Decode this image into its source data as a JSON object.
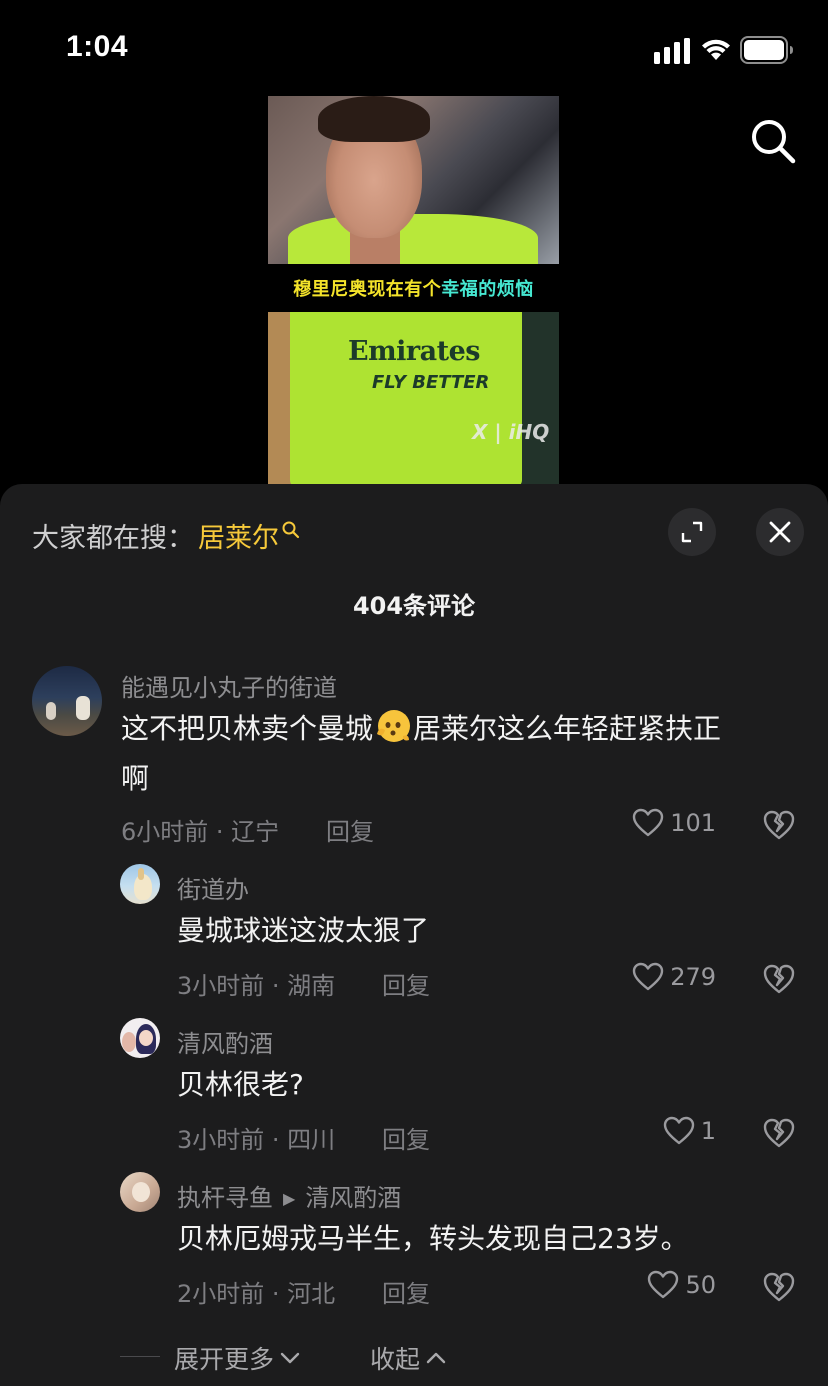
{
  "status_bar": {
    "time": "1:04"
  },
  "video": {
    "caption_a": "穆里尼奥现在有个",
    "caption_b": "幸福的烦恼",
    "sponsor_line1": "Emirates",
    "sponsor_line2": "FLY BETTER",
    "watermark": "X | iHQ"
  },
  "sheet": {
    "trending_prefix": "大家都在搜：",
    "trending_keyword": "居莱尔",
    "comment_count": "404条评论",
    "expand_more": "展开更多",
    "collapse": "收起"
  },
  "comments": [
    {
      "user": "能遇见小丸子的街道",
      "text": "这不把贝林卖个曼城🫣居莱尔这么年轻赶紧扶正啊",
      "text_part1": "这不把贝林卖个曼城",
      "text_part2": "居莱尔这么年轻赶紧扶正",
      "text_part3": "啊",
      "meta": "6小时前 · 辽宁",
      "reply": "回复",
      "likes": "101"
    },
    {
      "user": "街道办",
      "text": "曼城球迷这波太狠了",
      "meta": "3小时前 · 湖南",
      "reply": "回复",
      "likes": "279"
    },
    {
      "user": "清风酌酒",
      "text": "贝林很老?",
      "meta": "3小时前 · 四川",
      "reply": "回复",
      "likes": "1"
    },
    {
      "user": "执杆寻鱼",
      "reply_to": "清风酌酒",
      "text": "贝林厄姆戎马半生，转头发现自己23岁。",
      "meta": "2小时前 · 河北",
      "reply": "回复",
      "likes": "50"
    }
  ],
  "icons": {
    "search": "search-icon",
    "expand": "expand-icon",
    "close": "close-icon",
    "like": "heart-icon",
    "dislike": "broken-heart-icon"
  },
  "colors": {
    "keyword": "#f6c93a",
    "sheet_bg": "#1c1c1d",
    "caption_yellow": "#f4e32a",
    "caption_cyan": "#46e8d2"
  }
}
